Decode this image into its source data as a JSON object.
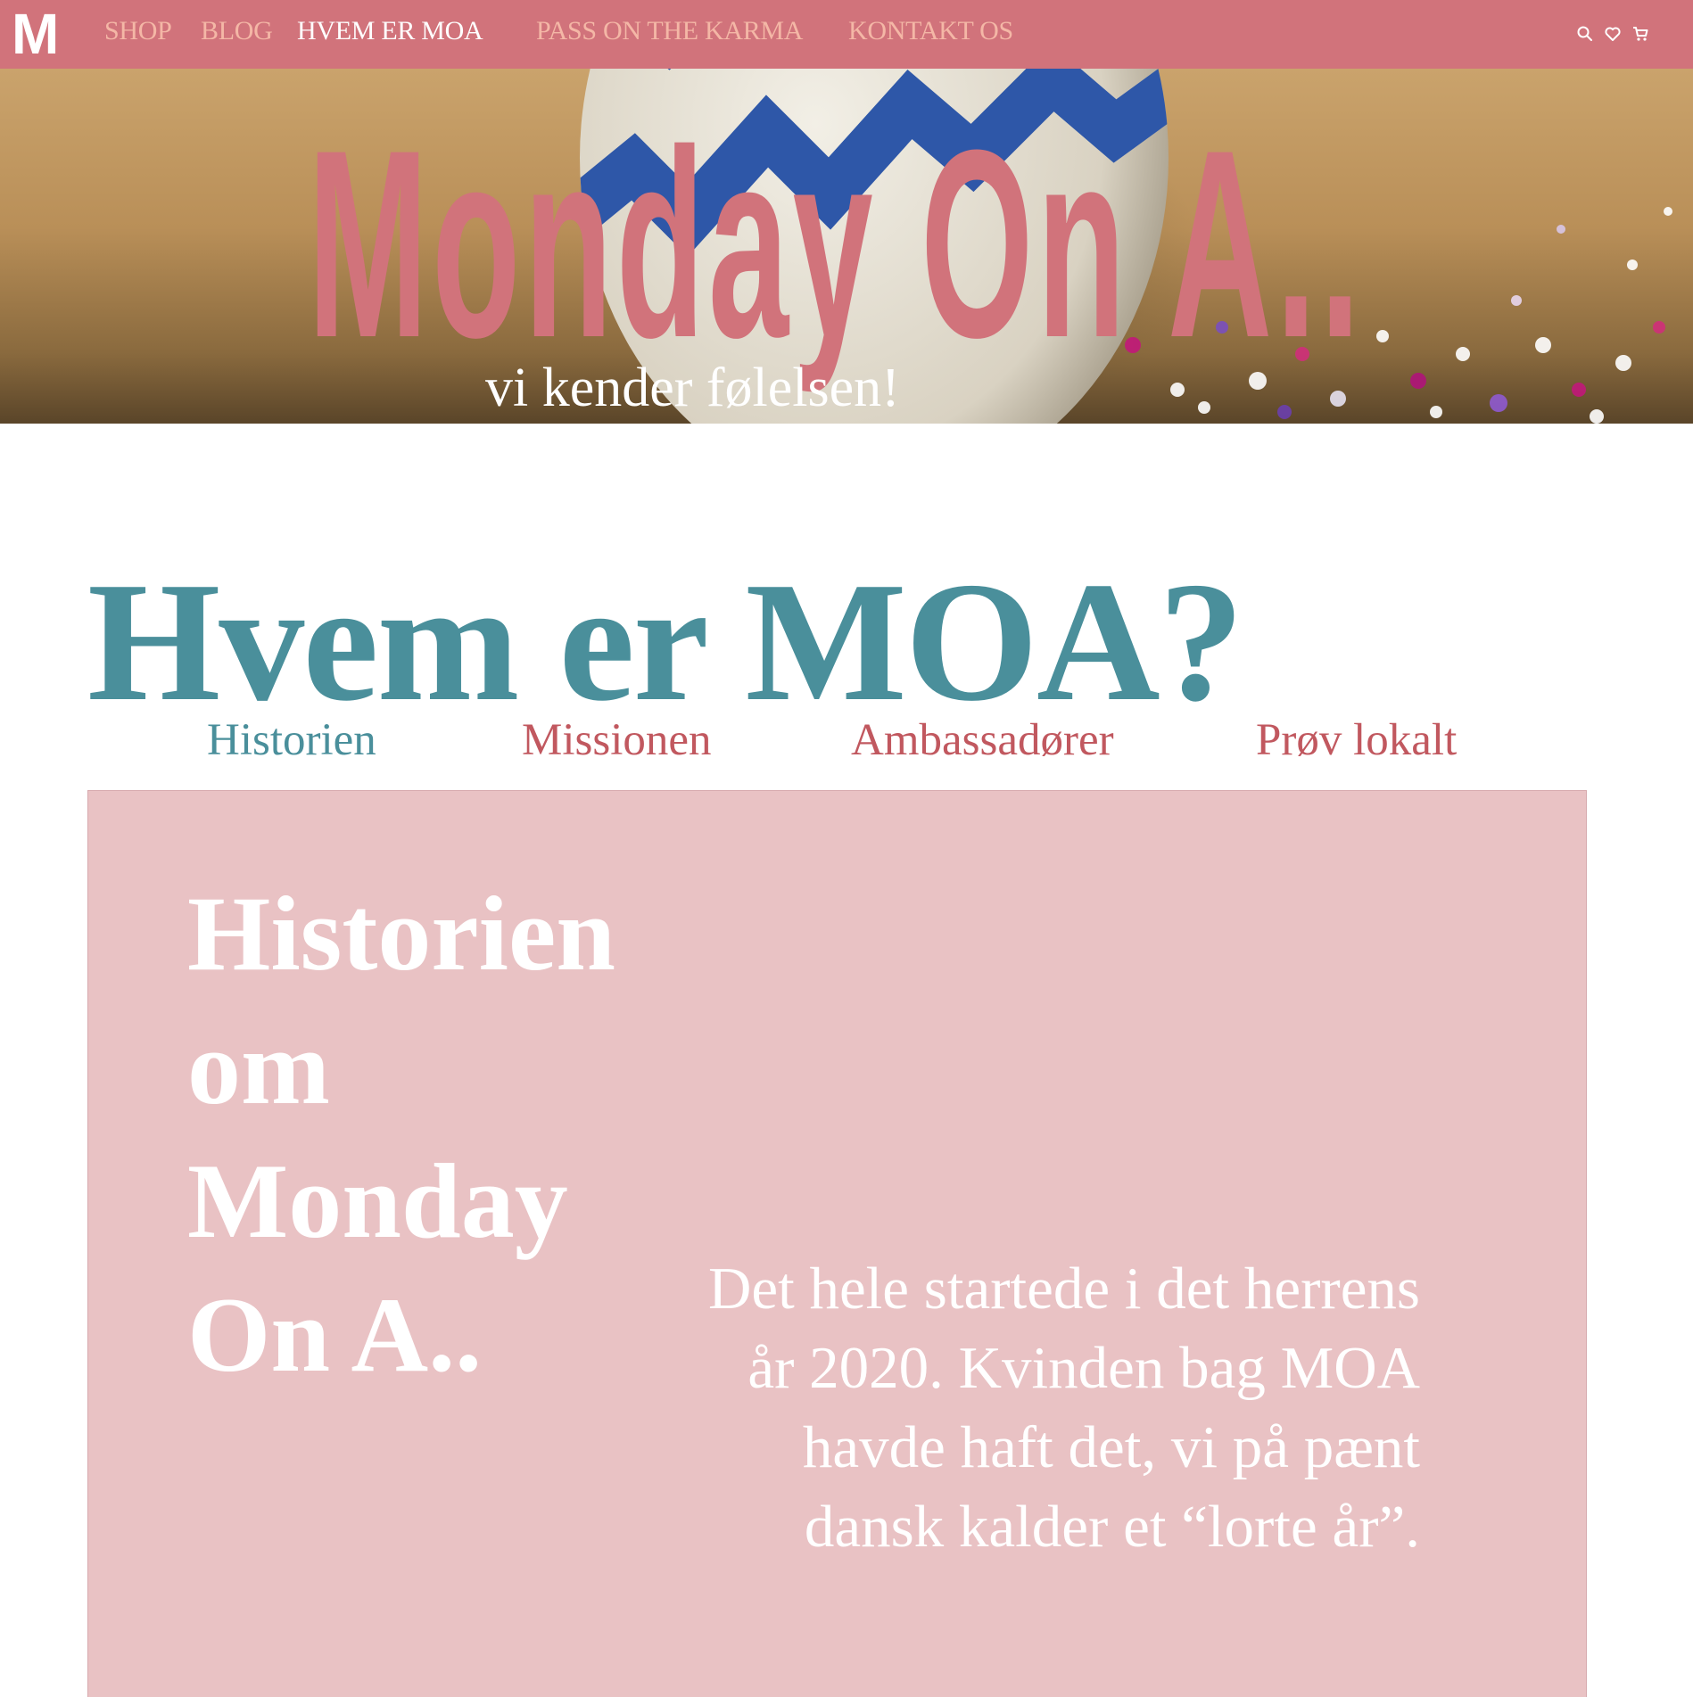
{
  "header": {
    "logo": "M",
    "nav": [
      {
        "label": "SHOP"
      },
      {
        "label": "BLOG"
      },
      {
        "label": "HVEM ER MOA"
      },
      {
        "label": "PASS ON THE KARMA"
      },
      {
        "label": "KONTAKT OS"
      }
    ],
    "active_nav": "HVEM ER MOA",
    "tools": [
      "search-icon",
      "heart-icon",
      "cart-icon"
    ]
  },
  "hero": {
    "title": "Monday On A..",
    "subtitle": "vi kender følelsen!"
  },
  "page": {
    "title": "Hvem er MOA?",
    "tabs": [
      {
        "label": "Historien"
      },
      {
        "label": "Missionen"
      },
      {
        "label": "Ambassadører"
      },
      {
        "label": "Prøv lokalt"
      }
    ],
    "active_tab": "Historien"
  },
  "story": {
    "heading": "Historien om Monday On A..",
    "body": "Det hele startede i det herrens år 2020. Kvinden bag MOA havde haft det, vi på pænt dansk kalder et “lorte år”."
  },
  "colors": {
    "accent_pink": "#d1737b",
    "nav_inactive": "#f4b7a6",
    "teal": "#4a8f9b",
    "panel_pink": "#e9c2c4",
    "tab_red": "#c1585f"
  }
}
